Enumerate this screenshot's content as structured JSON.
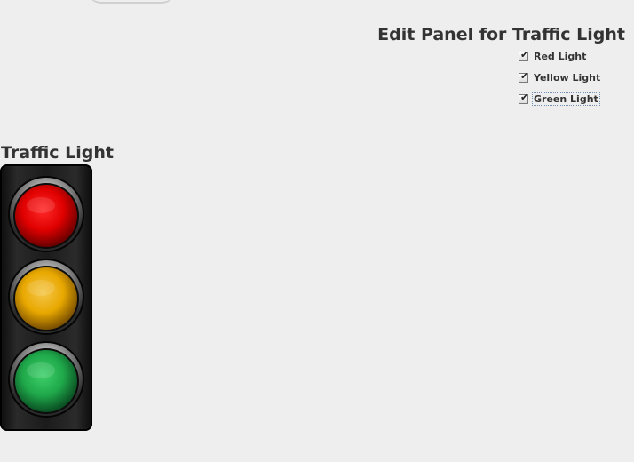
{
  "edit_panel": {
    "title": "Edit Panel for Traffic Light",
    "checkboxes": [
      {
        "label": "Red Light",
        "checked": true
      },
      {
        "label": "Yellow Light",
        "checked": true
      },
      {
        "label": "Green Light",
        "checked": true,
        "focused": true
      }
    ],
    "check_glyph": "✔"
  },
  "traffic_light": {
    "title": "Traffic Light",
    "lamps": [
      {
        "name": "red",
        "on": true,
        "color": "#e00000"
      },
      {
        "name": "yellow",
        "on": true,
        "color": "#e8a800"
      },
      {
        "name": "green",
        "on": true,
        "color": "#1fa84a"
      }
    ]
  },
  "colors": {
    "background": "#eeeeee",
    "text": "#333333",
    "housing": "#1b1b1b"
  }
}
